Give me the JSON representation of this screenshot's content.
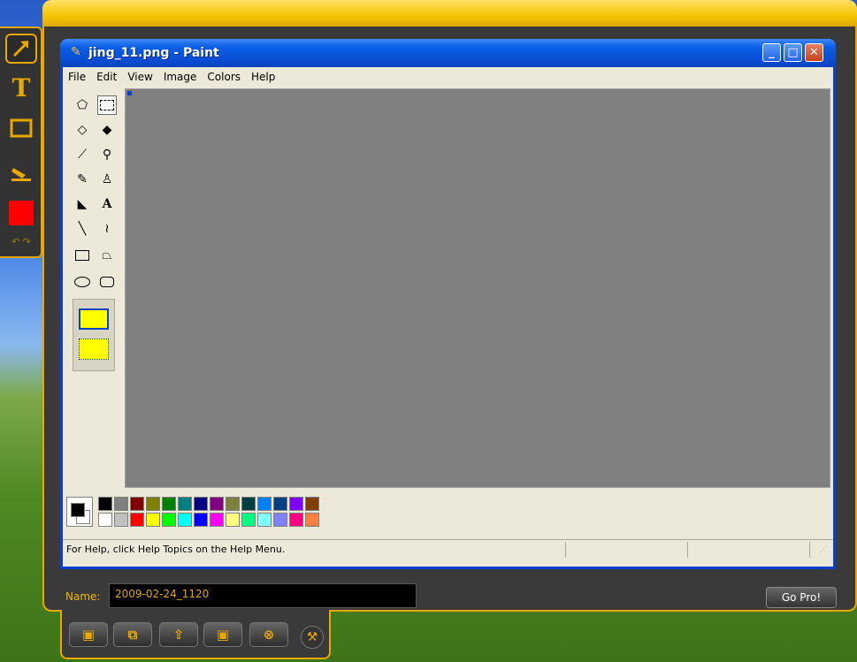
{
  "paint": {
    "title": "jing_11.png - Paint",
    "menu": [
      "File",
      "Edit",
      "View",
      "Image",
      "Colors",
      "Help"
    ],
    "status": "For Help, click Help Topics on the Help Menu.",
    "tools": [
      "free-form-select",
      "select",
      "eraser",
      "fill",
      "pick-color",
      "magnifier",
      "pencil",
      "brush",
      "airbrush",
      "text",
      "line",
      "curve",
      "rectangle",
      "polygon",
      "ellipse",
      "rounded-rectangle"
    ],
    "palette_top": [
      "#000000",
      "#808080",
      "#800000",
      "#808000",
      "#008000",
      "#008080",
      "#000080",
      "#800080",
      "#808040",
      "#004040",
      "#0080ff",
      "#004080",
      "#8000ff",
      "#804000"
    ],
    "palette_bottom": [
      "#ffffff",
      "#c0c0c0",
      "#ff0000",
      "#ffff00",
      "#00ff00",
      "#00ffff",
      "#0000ff",
      "#ff00ff",
      "#ffff80",
      "#00ff80",
      "#80ffff",
      "#8080ff",
      "#ff0080",
      "#ff8040"
    ],
    "foreground": "#000000",
    "background": "#ffffff"
  },
  "jing": {
    "name_label": "Name:",
    "name_value": "2009-02-24_1120",
    "go_pro": "Go Pro!",
    "current_color": "#ff0000",
    "accent": "#e8a800"
  }
}
